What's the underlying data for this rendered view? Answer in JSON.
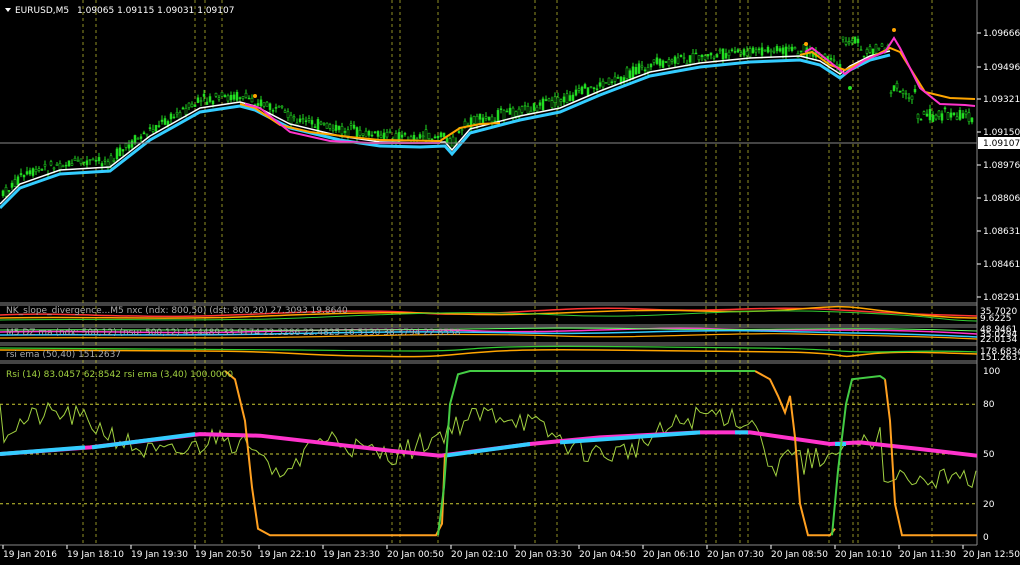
{
  "title": {
    "symbol": "EURUSD,M5",
    "ohlc": "1.09065 1.09115 1.09031 1.09107"
  },
  "price_axis": {
    "labels": [
      "1.09666",
      "1.09496",
      "1.09321",
      "1.09150",
      "1.08976",
      "1.08806",
      "1.08631",
      "1.08461",
      "1.08291"
    ],
    "current": "1.09107"
  },
  "indicators": {
    "p1": {
      "label": "NK_slope_divergence...M5 nxc (ndx: 800,50) (dst: 800,20) 27.3093 19.8640",
      "ticks": [
        "35.7020",
        "9.6225"
      ]
    },
    "p2": {
      "label": "M5 DZ ma (ndx: 500,12) (nsu: 500,12) 43.4489 33.9174 22.3286 22.4825 16.5130 38.3794 22.8558",
      "ticks": [
        "48.9461",
        "35.0294",
        "22.0134"
      ]
    },
    "p3": {
      "label": "rsi ema (50,40) 151.2637",
      "ticks": [
        "178.6834",
        "151.2637"
      ]
    },
    "p4": {
      "label": "Rsi (14) 83.0457 62.8542 rsi ema (3,40) 100.0000",
      "ticks": [
        "100",
        "80",
        "50",
        "20",
        "0"
      ]
    }
  },
  "time_axis": [
    "19 Jan 2016",
    "19 Jan 18:10",
    "19 Jan 19:30",
    "19 Jan 20:50",
    "19 Jan 22:10",
    "19 Jan 23:30",
    "20 Jan 00:50",
    "20 Jan 02:10",
    "20 Jan 03:30",
    "20 Jan 04:50",
    "20 Jan 06:10",
    "20 Jan 07:30",
    "20 Jan 08:50",
    "20 Jan 10:10",
    "20 Jan 11:30",
    "20 Jan 12:50"
  ],
  "colors": {
    "candle": "#22dd22",
    "ma_cyan": "#33ccff",
    "ma_white": "#ffffff",
    "ma_orange": "#ffa500",
    "ma_magenta": "#ff33cc",
    "rsi_light": "#a0d040",
    "rsi_green": "#44cc44",
    "rsi_orange": "#ffa020",
    "grid_yellow": "#cccc33",
    "axis": "#ffffff"
  }
}
